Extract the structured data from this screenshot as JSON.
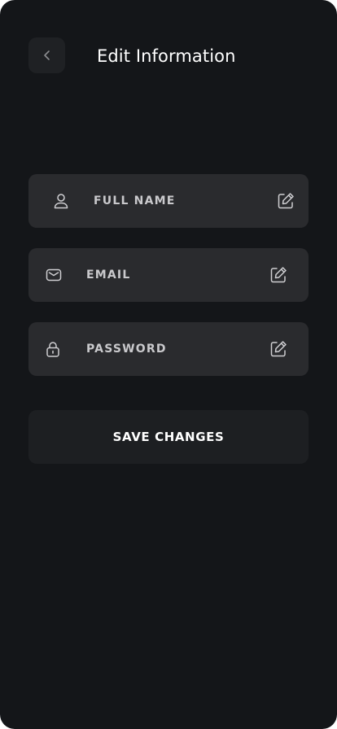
{
  "header": {
    "title": "Edit Information",
    "back_icon": "chevron-left-icon"
  },
  "fields": [
    {
      "label": "FULL NAME",
      "icon": "user-icon",
      "action_icon": "edit-icon"
    },
    {
      "label": "EMAIL",
      "icon": "mail-icon",
      "action_icon": "edit-icon"
    },
    {
      "label": "PASSWORD",
      "icon": "lock-icon",
      "action_icon": "edit-icon"
    }
  ],
  "actions": {
    "save_label": "SAVE CHANGES"
  },
  "colors": {
    "background": "#141619",
    "field": "#2a2b2e",
    "button": "#1d1f22",
    "text": "#ffffff",
    "label": "#c9c9cc"
  }
}
